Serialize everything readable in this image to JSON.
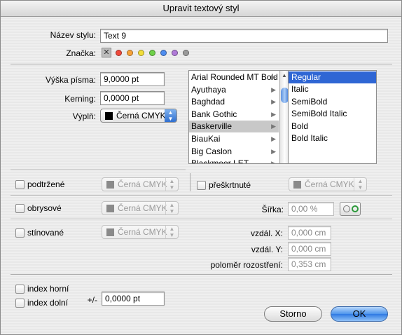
{
  "window": {
    "title": "Upravit textový styl"
  },
  "style_name": {
    "label": "Název stylu:",
    "value": "Text 9"
  },
  "tag": {
    "label": "Značka:",
    "clear_glyph": "✕",
    "colors": [
      "#f04a3c",
      "#f7a23a",
      "#f2de3a",
      "#6fd14a",
      "#4f8ef0",
      "#b07ad8",
      "#9a9a9a"
    ]
  },
  "font_size": {
    "label": "Výška písma:",
    "value": "9,0000 pt"
  },
  "kerning": {
    "label": "Kerning:",
    "value": "0,0000 pt"
  },
  "fill": {
    "label": "Výplň:",
    "value": "Černá CMYK"
  },
  "font_families": [
    "Arial Rounded MT Bold",
    "Ayuthaya",
    "Baghdad",
    "Bank Gothic",
    "Baskerville",
    "BiauKai",
    "Big Caslon",
    "Blackmoor LET"
  ],
  "selected_family": "Baskerville",
  "font_styles": [
    "Regular",
    "Italic",
    "SemiBold",
    "SemiBold Italic",
    "Bold",
    "Bold Italic"
  ],
  "selected_style": "Regular",
  "underline": {
    "label": "podtržené",
    "color": "Černá CMYK"
  },
  "strikethrough": {
    "label": "přeškrtnuté",
    "color": "Černá CMYK"
  },
  "outline": {
    "label": "obrysové",
    "color": "Černá CMYK",
    "width_label": "Šířka:",
    "width_value": "0,00 %"
  },
  "shadow": {
    "label": "stínované",
    "color": "Černá CMYK",
    "offset_x_label": "vzdál. X:",
    "offset_x": "0,000 cm",
    "offset_y_label": "vzdál. Y:",
    "offset_y": "0,000 cm",
    "blur_label": "poloměr rozostření:",
    "blur": "0,353 cm"
  },
  "superscript": {
    "label": "index horní"
  },
  "subscript": {
    "label": "index dolní"
  },
  "offset": {
    "label": "+/-",
    "value": "0,0000 pt"
  },
  "buttons": {
    "cancel": "Storno",
    "ok": "OK"
  }
}
